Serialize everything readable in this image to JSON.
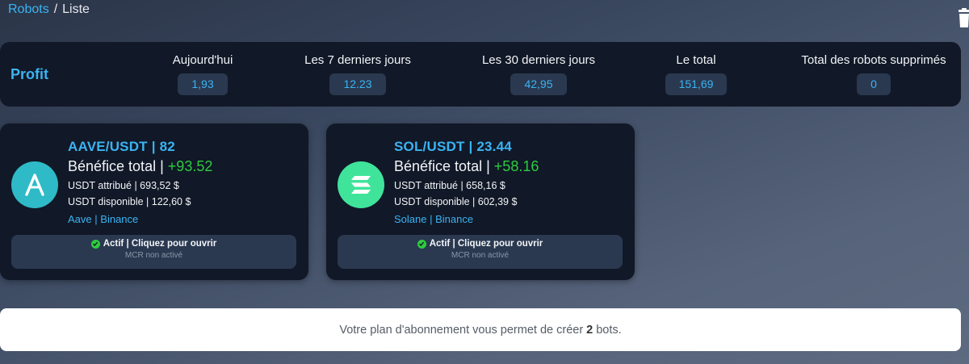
{
  "breadcrumb": {
    "root": "Robots",
    "separator": "/",
    "current": "Liste"
  },
  "profit": {
    "title": "Profit",
    "stats": [
      {
        "label": "Aujourd'hui",
        "value": "1,93"
      },
      {
        "label": "Les 7 derniers jours",
        "value": "12.23"
      },
      {
        "label": "Les 30 derniers jours",
        "value": "42,95"
      },
      {
        "label": "Le total",
        "value": "151,69"
      },
      {
        "label": "Total des robots supprimés",
        "value": "0"
      }
    ]
  },
  "bots": [
    {
      "pair": "AAVE/USDT | 82",
      "profit_label": "Bénéfice total",
      "profit_value": "+93.52",
      "allocated": "USDT attribué | 693,52 $",
      "available": "USDT disponible | 122,60 $",
      "coin": "Aave",
      "exchange": "Binance",
      "status": "Actif | Cliquez pour ouvrir",
      "mcr": "MCR non activé",
      "logo_color": "#2ebac6",
      "logo_icon": "aave-icon"
    },
    {
      "pair": "SOL/USDT | 23.44",
      "profit_label": "Bénéfice total",
      "profit_value": "+58.16",
      "allocated": "USDT attribué | 658,16 $",
      "available": "USDT disponible | 602,39 $",
      "coin": "Solane",
      "exchange": "Binance",
      "status": "Actif | Cliquez pour ouvrir",
      "mcr": "MCR non activé",
      "logo_color": "#3fe49a",
      "logo_icon": "solana-icon"
    }
  ],
  "notice": {
    "before": "Votre plan d'abonnement vous permet de créer",
    "count": "2",
    "after": "bots."
  },
  "icons": {
    "trash": "trash-icon",
    "status": "check-circle-icon"
  },
  "colors": {
    "accent": "#3ab4f2",
    "gain": "#2ecc40",
    "panel": "#111827"
  }
}
